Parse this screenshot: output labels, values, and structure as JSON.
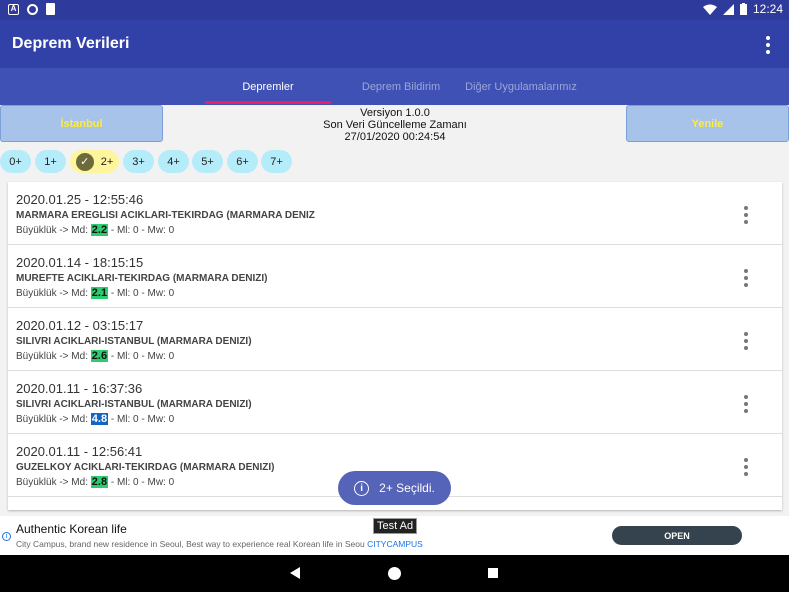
{
  "status": {
    "time": "12:24"
  },
  "app": {
    "title": "Deprem Verileri"
  },
  "tabs": [
    {
      "label": "Depremler",
      "active": true
    },
    {
      "label": "Deprem Bildirim",
      "active": false
    },
    {
      "label": "Diğer Uygulamalarımız",
      "active": false
    }
  ],
  "toolbar": {
    "city_button": "İstanbul",
    "refresh_button": "Yenile",
    "version": "Versiyon 1.0.0",
    "update_label": "Son Veri Güncelleme Zamanı",
    "update_time": "27/01/2020 00:24:54"
  },
  "filters": [
    {
      "label": "0+",
      "selected": false
    },
    {
      "label": "1+",
      "selected": false
    },
    {
      "label": "2+",
      "selected": true
    },
    {
      "label": "3+",
      "selected": false
    },
    {
      "label": "4+",
      "selected": false
    },
    {
      "label": "5+",
      "selected": false
    },
    {
      "label": "6+",
      "selected": false
    },
    {
      "label": "7+",
      "selected": false
    }
  ],
  "mag_prefix": "Büyüklük -> Md:",
  "earthquakes": [
    {
      "date": "2020.01.25 - 12:55:46",
      "location": "MARMARA EREGLISI ACIKLARI-TEKIRDAG (MARMARA DENIZ",
      "md": "2.2",
      "rest": " - Ml: 0 - Mw: 0",
      "highlight": "#2ecc71"
    },
    {
      "date": "2020.01.14 - 18:15:15",
      "location": "MUREFTE ACIKLARI-TEKIRDAG (MARMARA DENIZI)",
      "md": "2.1",
      "rest": " - Ml: 0 - Mw: 0",
      "highlight": "#2ecc71"
    },
    {
      "date": "2020.01.12 - 03:15:17",
      "location": "SILIVRI ACIKLARI-ISTANBUL (MARMARA DENIZI)",
      "md": "2.6",
      "rest": " - Ml: 0 - Mw: 0",
      "highlight": "#2ecc71"
    },
    {
      "date": "2020.01.11 - 16:37:36",
      "location": "SILIVRI ACIKLARI-ISTANBUL (MARMARA DENIZI)",
      "md": "4.8",
      "rest": " - Ml: 0 - Mw: 0",
      "highlight": "#1565c0"
    },
    {
      "date": "2020.01.11 - 12:56:41",
      "location": "GUZELKOY ACIKLARI-TEKIRDAG (MARMARA DENIZI)",
      "md": "2.8",
      "rest": " - Ml: 0 - Mw: 0",
      "highlight": "#2ecc71"
    }
  ],
  "toast": {
    "text": "2+ Seçildi."
  },
  "ad": {
    "badge": "Test Ad",
    "headline": "Authentic Korean life",
    "body": "City Campus, brand new residence in Seoul, Best way to experience real Korean life in Seou",
    "advertiser": "CITYCAMPUS",
    "cta": "OPEN"
  }
}
